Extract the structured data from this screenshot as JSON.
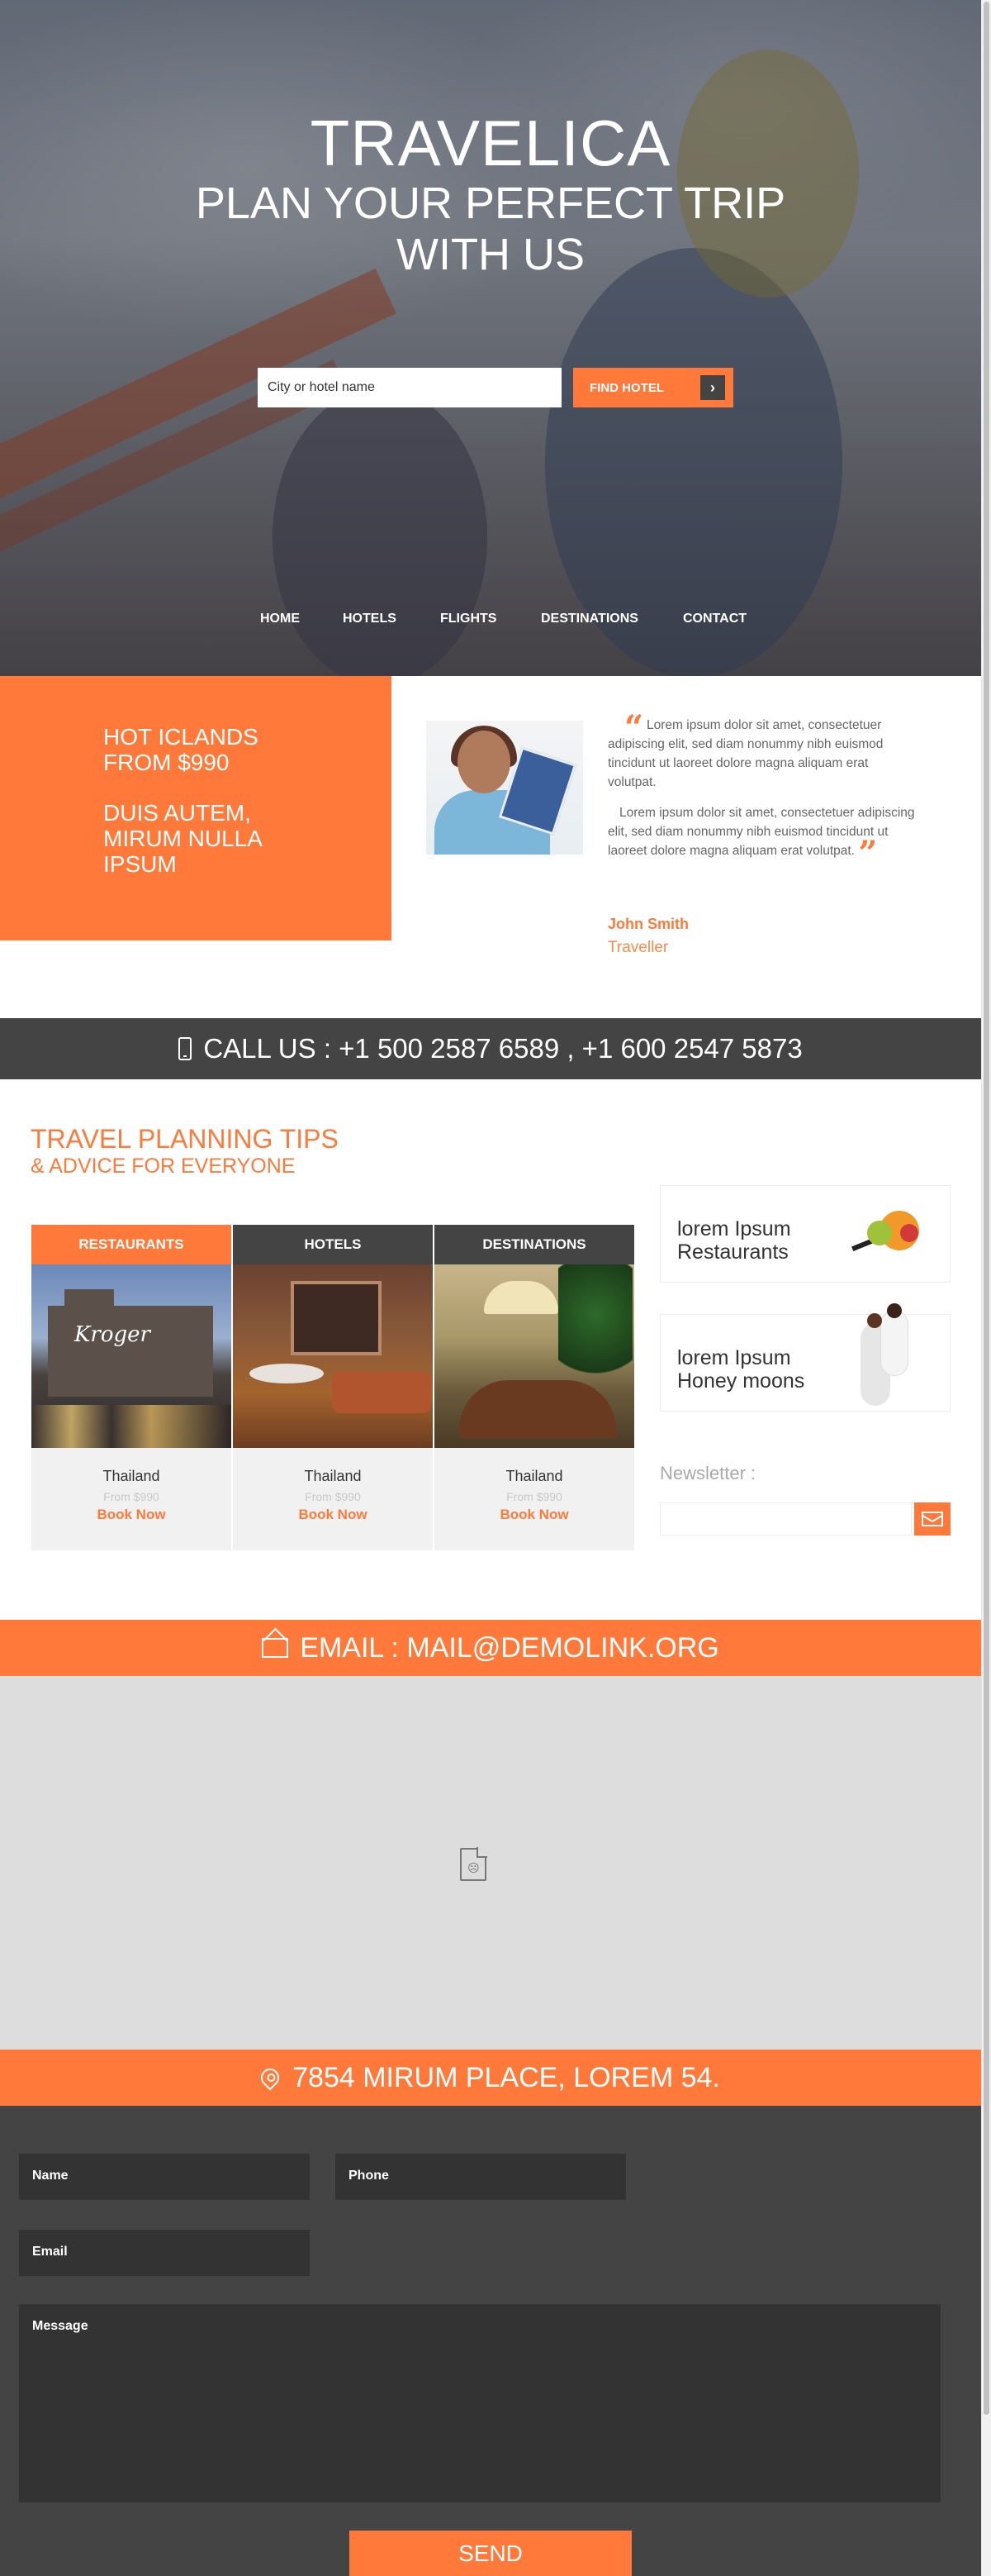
{
  "hero": {
    "title": "TRAVELICA",
    "subtitle": "PLAN YOUR PERFECT TRIP WITH US",
    "search_placeholder": "City or hotel name",
    "find_button": "FIND HOTEL",
    "arrow": "›"
  },
  "nav": {
    "items": [
      {
        "label": "HOME"
      },
      {
        "label": "HOTELS"
      },
      {
        "label": "FLIGHTS"
      },
      {
        "label": "DESTINATIONS"
      },
      {
        "label": "CONTACT"
      }
    ]
  },
  "offer": {
    "line1": "HOT ICLANDS FROM $990",
    "line2": "DUIS AUTEM, MIRUM NULLA IPSUM"
  },
  "testimonial": {
    "quote1": "Lorem ipsum dolor sit amet, consectetuer adipiscing elit, sed diam nonummy nibh euismod tincidunt ut laoreet dolore magna aliquam erat volutpat.",
    "quote2": "Lorem ipsum dolor sit amet, consectetuer adipiscing elit, sed diam nonummy nibh euismod tincidunt ut laoreet dolore magna aliquam erat volutpat.",
    "open_mark": "“",
    "close_mark": "”",
    "author": "John Smith",
    "role": "Traveller"
  },
  "call": {
    "text": "CALL US : +1 500 2587 6589 , +1 600 2547 5873"
  },
  "tips": {
    "title": "TRAVEL PLANNING TIPS",
    "subtitle": "& ADVICE FOR EVERYONE",
    "cards": [
      {
        "tab": "RESTAURANTS",
        "place": "Thailand",
        "price": "From $990",
        "cta": "Book Now",
        "tab_color": "#ff7a3a",
        "image_sign": "Kroger"
      },
      {
        "tab": "HOTELS",
        "place": "Thailand",
        "price": "From $990",
        "cta": "Book Now",
        "tab_color": "#444444"
      },
      {
        "tab": "DESTINATIONS",
        "place": "Thailand",
        "price": "From $990",
        "cta": "Book Now",
        "tab_color": "#444444"
      }
    ]
  },
  "sidebar": {
    "box1": "lorem Ipsum Restaurants",
    "box2": "lorem Ipsum Honey moons",
    "newsletter_label": "Newsletter :"
  },
  "email": {
    "text": "EMAIL : MAIL@DEMOLINK.ORG"
  },
  "address": {
    "text": "7854 MIRUM PLACE, LOREM 54."
  },
  "form": {
    "name": "Name",
    "phone": "Phone",
    "email": "Email",
    "message": "Message",
    "send": "SEND"
  },
  "colors": {
    "accent": "#ff7a3a",
    "dark": "#444444"
  }
}
